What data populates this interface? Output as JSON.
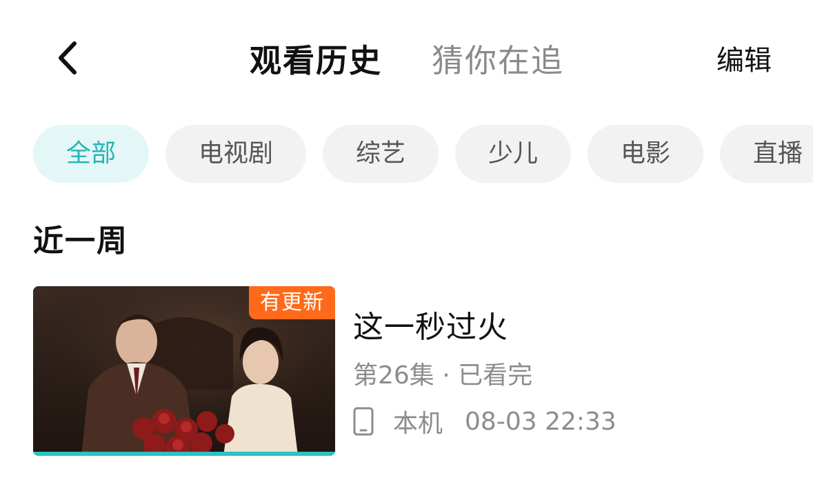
{
  "header": {
    "tabs": [
      {
        "label": "观看历史",
        "active": true
      },
      {
        "label": "猜你在追",
        "active": false
      }
    ],
    "edit_label": "编辑",
    "back_icon": "chevron-left-icon"
  },
  "filters": [
    {
      "label": "全部",
      "selected": true
    },
    {
      "label": "电视剧",
      "selected": false
    },
    {
      "label": "综艺",
      "selected": false
    },
    {
      "label": "少儿",
      "selected": false
    },
    {
      "label": "电影",
      "selected": false
    },
    {
      "label": "直播",
      "selected": false
    }
  ],
  "section": {
    "title": "近一周"
  },
  "history": [
    {
      "title": "这一秒过火",
      "badge": "有更新",
      "episode": "第26集 · 已看完",
      "device_icon": "phone-icon",
      "device": "本机",
      "time": "08-03 22:33",
      "progress": 1.0
    }
  ],
  "colors": {
    "accent": "#25b5b5",
    "chip_selected_bg": "#e4f7f7",
    "chip_bg": "#f2f2f2",
    "badge": "#ff6a1a",
    "progress": "#2ac3c3"
  }
}
